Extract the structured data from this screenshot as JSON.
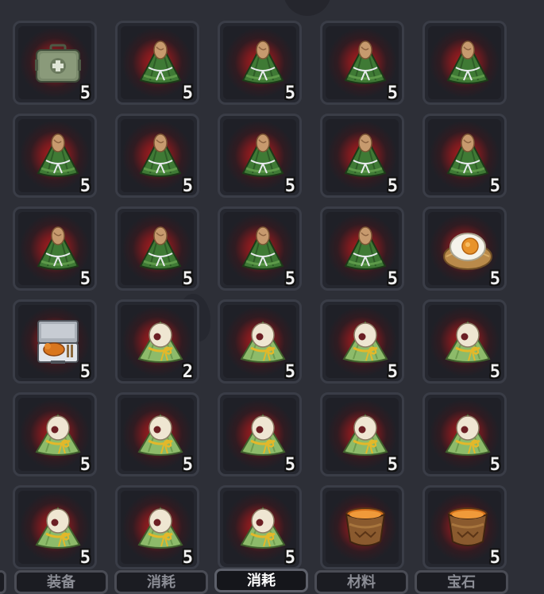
{
  "inventory": {
    "rows": [
      [
        {
          "item": "medkit-case-icon",
          "count": "5"
        },
        {
          "item": "green-zongzi-icon",
          "count": "5"
        },
        {
          "item": "green-zongzi-icon",
          "count": "5"
        },
        {
          "item": "green-zongzi-icon",
          "count": "5"
        },
        {
          "item": "green-zongzi-icon",
          "count": ""
        }
      ],
      [
        {
          "item": "green-zongzi-icon",
          "count": "5"
        },
        {
          "item": "green-zongzi-icon",
          "count": "5"
        },
        {
          "item": "green-zongzi-icon",
          "count": "5"
        },
        {
          "item": "green-zongzi-icon",
          "count": "5"
        },
        {
          "item": "green-zongzi-icon",
          "count": "5"
        }
      ],
      [
        {
          "item": "green-zongzi-icon",
          "count": "5"
        },
        {
          "item": "green-zongzi-icon",
          "count": "5"
        },
        {
          "item": "green-zongzi-icon",
          "count": "5"
        },
        {
          "item": "green-zongzi-icon",
          "count": "5"
        },
        {
          "item": "salted-egg-icon",
          "count": "5"
        }
      ],
      [
        {
          "item": "roast-chicken-case-icon",
          "count": "5"
        },
        {
          "item": "red-bean-zongzi-icon",
          "count": "2"
        },
        {
          "item": "red-bean-zongzi-icon",
          "count": "5"
        },
        {
          "item": "red-bean-zongzi-icon",
          "count": "5"
        },
        {
          "item": "red-bean-zongzi-icon",
          "count": "5"
        }
      ],
      [
        {
          "item": "red-bean-zongzi-icon",
          "count": "5"
        },
        {
          "item": "red-bean-zongzi-icon",
          "count": "5"
        },
        {
          "item": "red-bean-zongzi-icon",
          "count": "5"
        },
        {
          "item": "red-bean-zongzi-icon",
          "count": "5"
        },
        {
          "item": "red-bean-zongzi-icon",
          "count": "5"
        }
      ],
      [
        {
          "item": "red-bean-zongzi-icon",
          "count": "5"
        },
        {
          "item": "red-bean-zongzi-icon",
          "count": "5"
        },
        {
          "item": "red-bean-zongzi-icon",
          "count": "5"
        },
        {
          "item": "wine-cup-icon",
          "count": ""
        },
        {
          "item": "wine-cup-icon",
          "count": "5"
        }
      ]
    ]
  },
  "tabs": [
    {
      "label": "装备",
      "active": false
    },
    {
      "label": "消耗",
      "active": false
    },
    {
      "label": "消耗",
      "active": true
    },
    {
      "label": "材料",
      "active": false
    },
    {
      "label": "宝石",
      "active": false
    }
  ],
  "colors": {
    "background": "#2d2f37",
    "slot_glow": "#b81e22",
    "count_text": "#f2f2f2",
    "active_tab_text": "#ffffff"
  }
}
